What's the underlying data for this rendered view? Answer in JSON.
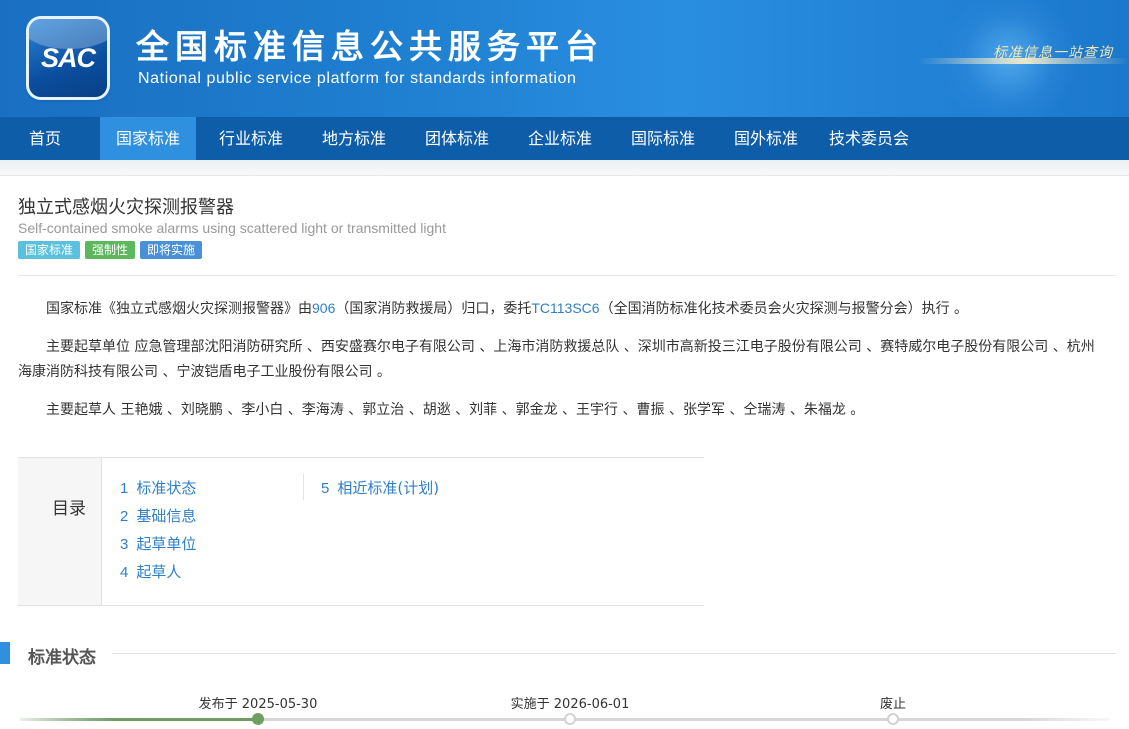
{
  "header": {
    "logo_text": "SAC",
    "title": "全国标准信息公共服务平台",
    "subtitle": "National public service platform  for standards information",
    "slogan": "标准信息一站查询"
  },
  "nav": {
    "items": [
      "首页",
      "国家标准",
      "行业标准",
      "地方标准",
      "团体标准",
      "企业标准",
      "国际标准",
      "国外标准",
      "技术委员会"
    ],
    "active_index": 1
  },
  "standard": {
    "title": "独立式感烟火灾探测报警器",
    "title_en": "Self-contained smoke alarms using scattered light or transmitted light",
    "tags": [
      {
        "label": "国家标准",
        "color": "#5bc0de"
      },
      {
        "label": "强制性",
        "color": "#5cb85c"
      },
      {
        "label": "即将实施",
        "color": "#4a90d9"
      }
    ]
  },
  "description": {
    "p1_prefix": "国家标准《独立式感烟火灾探测报警器》由",
    "p1_link1": "906",
    "p1_mid": "（国家消防救援局）归口，委托",
    "p1_link2": "TC113SC6",
    "p1_suffix": "（全国消防标准化技术委员会火灾探测与报警分会）执行 。",
    "p2": "主要起草单位 应急管理部沈阳消防研究所 、西安盛赛尔电子有限公司 、上海市消防救援总队 、深圳市高新投三江电子股份有限公司 、赛特威尔电子股份有限公司 、杭州海康消防科技有限公司 、宁波铠盾电子工业股份有限公司 。",
    "p3": "主要起草人 王艳娥 、刘晓鹏 、李小白 、李海涛 、郭立治 、胡逖 、刘菲 、郭金龙 、王宇行 、曹振 、张学军 、仝瑞涛 、朱福龙 。"
  },
  "toc": {
    "label": "目录",
    "items": [
      {
        "num": "1",
        "label": "标准状态"
      },
      {
        "num": "2",
        "label": "基础信息"
      },
      {
        "num": "3",
        "label": "起草单位"
      },
      {
        "num": "4",
        "label": "起草人"
      },
      {
        "num": "5",
        "label": "相近标准(计划)"
      }
    ]
  },
  "status_section": {
    "title": "标准状态",
    "timeline": [
      {
        "label": "发布于 2025-05-30",
        "done": true
      },
      {
        "label": "实施于 2026-06-01",
        "done": false
      },
      {
        "label": "废止",
        "done": false
      }
    ]
  },
  "colors": {
    "nav_bg": "#0e5da8",
    "nav_active": "#2f90e0",
    "link": "#2f7fc8",
    "timeline_done": "#6f9e63"
  }
}
